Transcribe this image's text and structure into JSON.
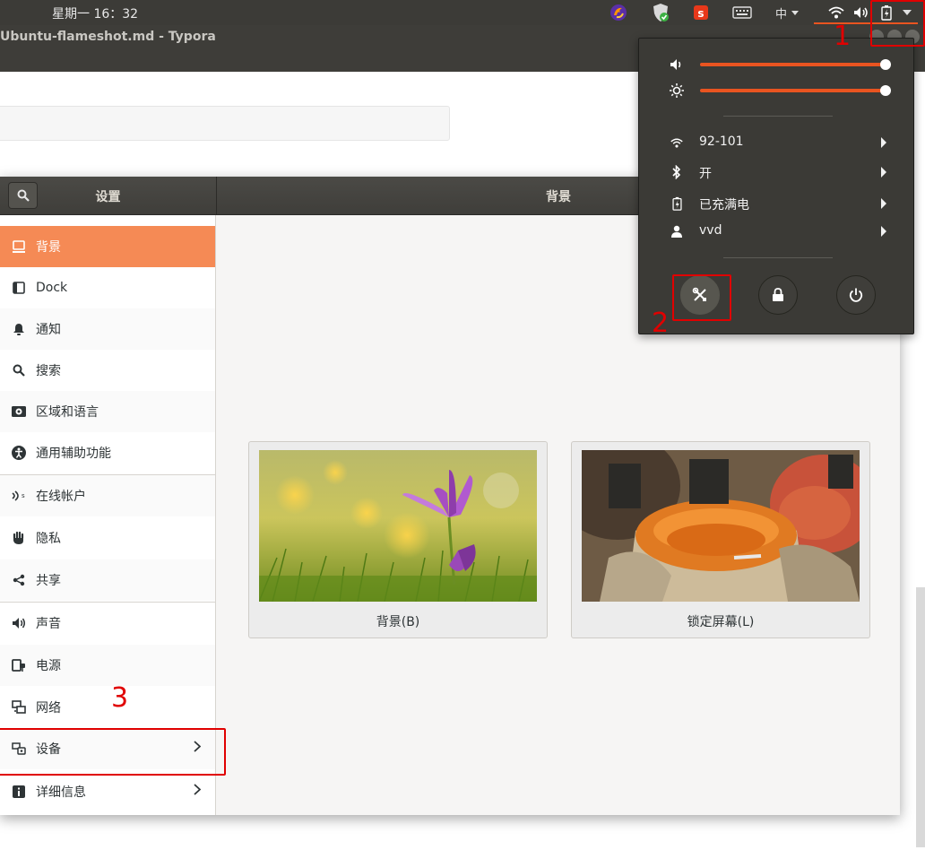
{
  "topbar": {
    "clock": "星期一 16：32",
    "input_method": "中",
    "icons": [
      "firefox-icon",
      "shield-icon",
      "sogou-icon",
      "keyboard-icon",
      "ime-icon",
      "wifi-icon",
      "volume-icon",
      "battery-icon",
      "dropdown-arrow-icon"
    ]
  },
  "typora": {
    "title": "Ubuntu-flameshot.md - Typora"
  },
  "settings": {
    "title_left": "设置",
    "title_right": "背景",
    "sidebar": [
      {
        "label": "背景",
        "icon": "background-icon",
        "active": true
      },
      {
        "label": "Dock",
        "icon": "dock-icon"
      },
      {
        "label": "通知",
        "icon": "bell-icon"
      },
      {
        "label": "搜索",
        "icon": "search-icon"
      },
      {
        "label": "区域和语言",
        "icon": "region-icon"
      },
      {
        "label": "通用辅助功能",
        "icon": "accessibility-icon"
      },
      {
        "label": "在线帐户",
        "icon": "online-accounts-icon"
      },
      {
        "label": "隐私",
        "icon": "hand-icon"
      },
      {
        "label": "共享",
        "icon": "share-icon"
      },
      {
        "label": "声音",
        "icon": "speaker-icon"
      },
      {
        "label": "电源",
        "icon": "power-plug-icon"
      },
      {
        "label": "网络",
        "icon": "network-icon"
      },
      {
        "label": "设备",
        "icon": "devices-icon",
        "chevron": true
      },
      {
        "label": "详细信息",
        "icon": "info-icon",
        "chevron": true
      }
    ],
    "cards": [
      {
        "label": "背景(B)",
        "image": "purple-crocus-flower"
      },
      {
        "label": "锁定屏幕(L)",
        "image": "spice-sacks"
      }
    ]
  },
  "system_menu": {
    "volume_level": 1.0,
    "brightness_level": 1.0,
    "rows": [
      {
        "icon": "wifi-icon",
        "label": "92-101"
      },
      {
        "icon": "bluetooth-icon",
        "label": "开"
      },
      {
        "icon": "battery-icon",
        "label": "已充满电"
      },
      {
        "icon": "user-icon",
        "label": "vvd"
      }
    ],
    "buttons": [
      "settings-tools-icon",
      "lock-icon",
      "power-icon"
    ]
  },
  "annotations": [
    "1",
    "2",
    "3"
  ],
  "colors": {
    "accent": "#e95420",
    "active_item": "#f58a55",
    "annotation_red": "#e00000",
    "panel": "#3b3a36"
  }
}
